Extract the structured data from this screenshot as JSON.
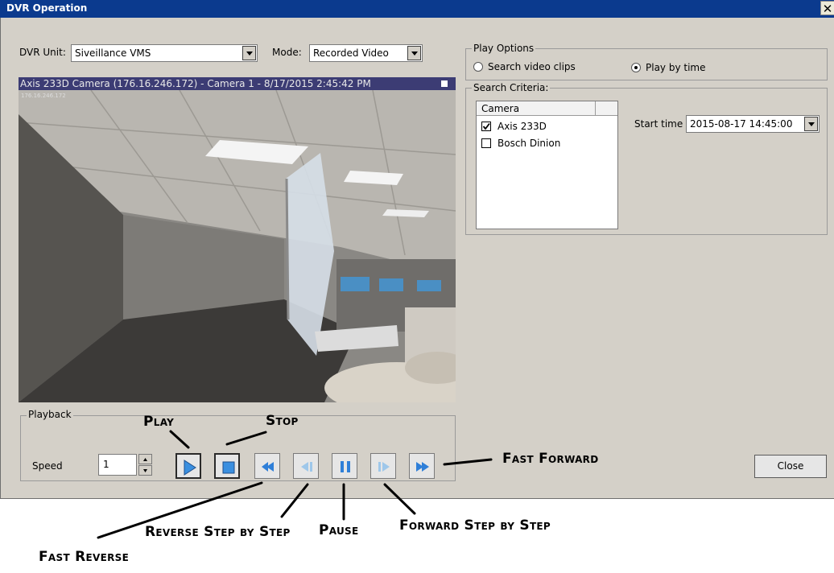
{
  "window": {
    "title": "DVR Operation",
    "close_glyph": "✕"
  },
  "dvr_unit": {
    "label": "DVR Unit:",
    "value": "Siveillance VMS"
  },
  "mode": {
    "label": "Mode:",
    "value": "Recorded Video"
  },
  "video": {
    "header": "Axis 233D Camera (176.16.246.172) - Camera 1 - 8/17/2015 2:45:42 PM",
    "overlay_ip": "176.16.246.172"
  },
  "playback": {
    "legend": "Playback",
    "speed_label": "Speed",
    "speed_value": "1"
  },
  "play_options": {
    "legend": "Play Options",
    "options": [
      {
        "label": "Search video clips",
        "selected": false
      },
      {
        "label": "Play by time",
        "selected": true
      }
    ]
  },
  "search_criteria": {
    "legend": "Search Criteria:",
    "column_header": "Camera",
    "cameras": [
      {
        "name": "Axis 233D",
        "checked": true
      },
      {
        "name": "Bosch Dinion",
        "checked": false
      }
    ],
    "start_time_label": "Start time",
    "start_time_value": "2015-08-17 14:45:00"
  },
  "close_button_label": "Close",
  "annotations": {
    "play": "Play",
    "stop": "Stop",
    "fast_forward": "Fast Forward",
    "reverse_step": "Reverse Step by Step",
    "pause": "Pause",
    "forward_step": "Forward Step by Step",
    "fast_reverse": "Fast Reverse"
  }
}
